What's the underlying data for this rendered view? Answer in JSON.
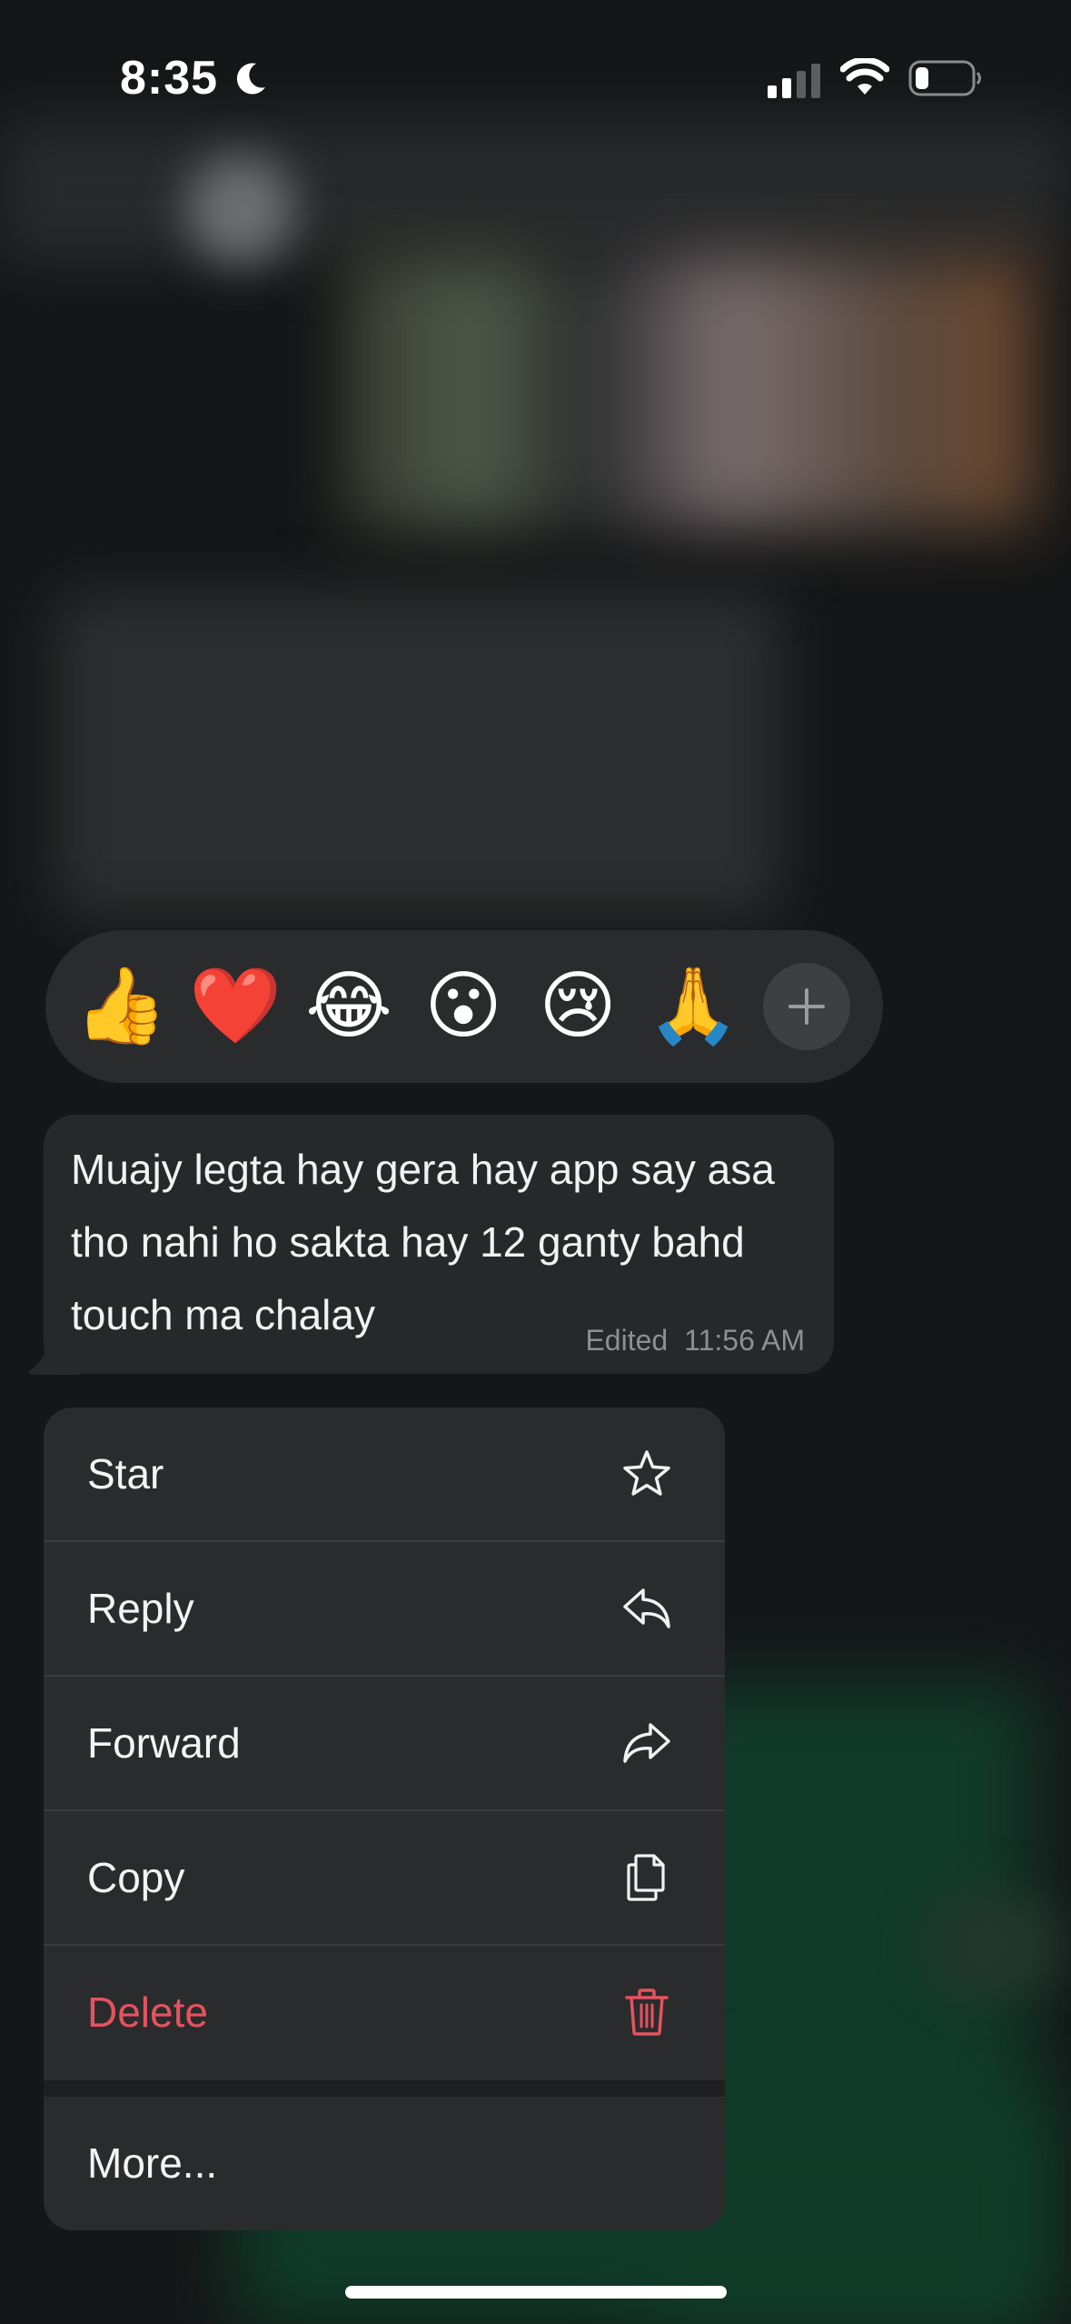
{
  "status_bar": {
    "time": "8:35",
    "icons": [
      "moon-icon",
      "signal-icon",
      "wifi-icon",
      "battery-icon"
    ]
  },
  "reactions": {
    "items": [
      {
        "emoji": "👍",
        "name": "thumbs-up"
      },
      {
        "emoji": "❤️",
        "name": "heart"
      },
      {
        "emoji": "😂",
        "name": "tears-of-joy"
      },
      {
        "emoji": "😮",
        "name": "surprised"
      },
      {
        "emoji": "😢",
        "name": "crying"
      },
      {
        "emoji": "🙏",
        "name": "praying-hands"
      }
    ],
    "more_icon": "plus-icon"
  },
  "message": {
    "text": "Muajy legta hay gera hay app say asa tho nahi ho sakta hay 12 ganty bahd touch ma chalay",
    "edited_label": "Edited",
    "time": "11:56 AM"
  },
  "menu": {
    "items": [
      {
        "label": "Star",
        "icon": "star-icon"
      },
      {
        "label": "Reply",
        "icon": "reply-icon"
      },
      {
        "label": "Forward",
        "icon": "forward-icon"
      },
      {
        "label": "Copy",
        "icon": "copy-icon"
      },
      {
        "label": "Delete",
        "icon": "trash-icon"
      }
    ],
    "more_label": "More..."
  },
  "colors": {
    "menu_bg": "#2a2b2d",
    "bubble_bg": "#262829",
    "destructive": "#e5535e"
  }
}
